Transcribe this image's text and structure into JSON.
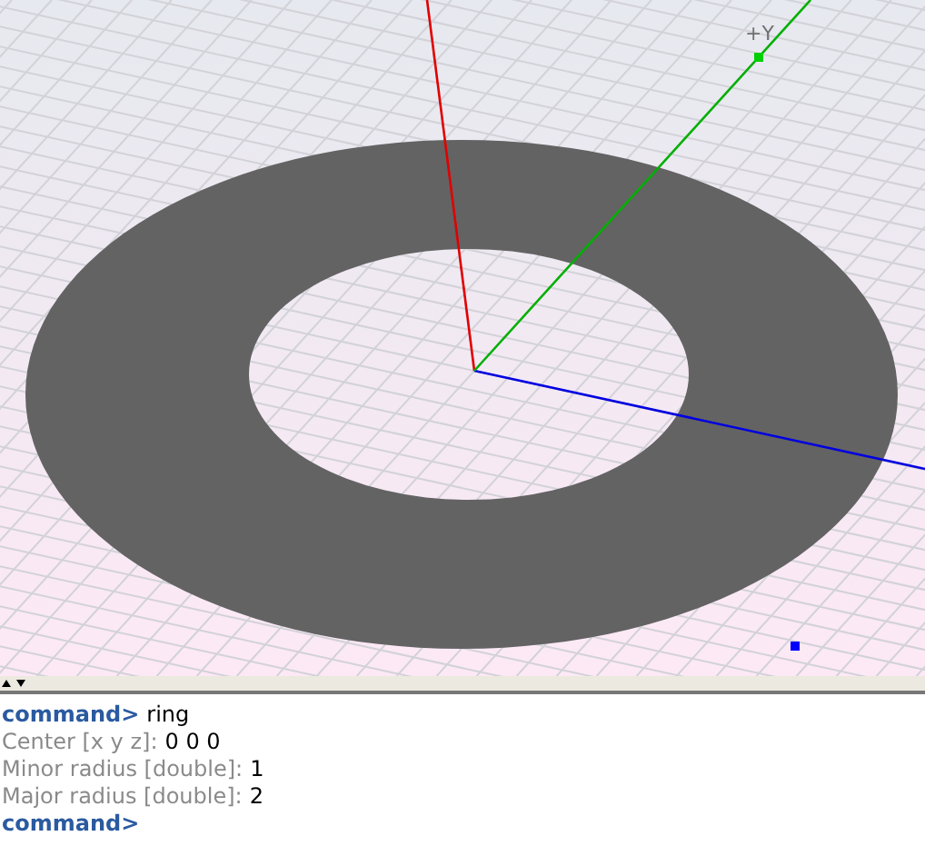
{
  "viewport": {
    "axis_label": "+Y"
  },
  "console": {
    "lines": [
      {
        "kind": "command",
        "prompt": "command>",
        "value": "ring"
      },
      {
        "kind": "input",
        "prompt": "Center [x y z]:",
        "value": "0 0 0"
      },
      {
        "kind": "input",
        "prompt": "Minor radius [double]:",
        "value": "1"
      },
      {
        "kind": "input",
        "prompt": "Major radius [double]:",
        "value": "2"
      },
      {
        "kind": "command",
        "prompt": "command>"
      }
    ]
  }
}
